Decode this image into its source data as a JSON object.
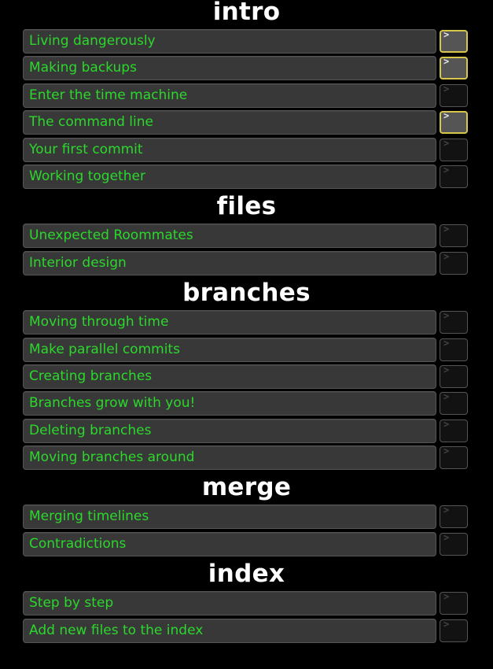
{
  "sections": [
    {
      "title": "intro",
      "levels": [
        {
          "label": "Living dangerously",
          "solved": true
        },
        {
          "label": "Making backups",
          "solved": true
        },
        {
          "label": "Enter the time machine",
          "solved": false
        },
        {
          "label": "The command line",
          "solved": true
        },
        {
          "label": "Your first commit",
          "solved": false
        },
        {
          "label": "Working together",
          "solved": false
        }
      ]
    },
    {
      "title": "files",
      "levels": [
        {
          "label": "Unexpected Roommates",
          "solved": false
        },
        {
          "label": "Interior design",
          "solved": false
        }
      ]
    },
    {
      "title": "branches",
      "levels": [
        {
          "label": "Moving through time",
          "solved": false
        },
        {
          "label": "Make parallel commits",
          "solved": false
        },
        {
          "label": "Creating branches",
          "solved": false
        },
        {
          "label": "Branches grow with you!",
          "solved": false
        },
        {
          "label": "Deleting branches",
          "solved": false
        },
        {
          "label": "Moving branches around",
          "solved": false
        }
      ]
    },
    {
      "title": "merge",
      "levels": [
        {
          "label": "Merging timelines",
          "solved": false
        },
        {
          "label": "Contradictions",
          "solved": false
        }
      ]
    },
    {
      "title": "index",
      "levels": [
        {
          "label": "Step by step",
          "solved": false
        },
        {
          "label": "Add new files to the index",
          "solved": false
        }
      ]
    }
  ],
  "icons": {
    "terminal_prompt": "prompt-icon",
    "prompt_glyph": ">"
  },
  "colors": {
    "background": "#000000",
    "level_button": "#383838",
    "level_text": "#2bd82b",
    "section_title": "#ffffff",
    "solved_border": "#d6c74a",
    "solved_fill": "#555555",
    "unsolved_fill": "#121212"
  }
}
